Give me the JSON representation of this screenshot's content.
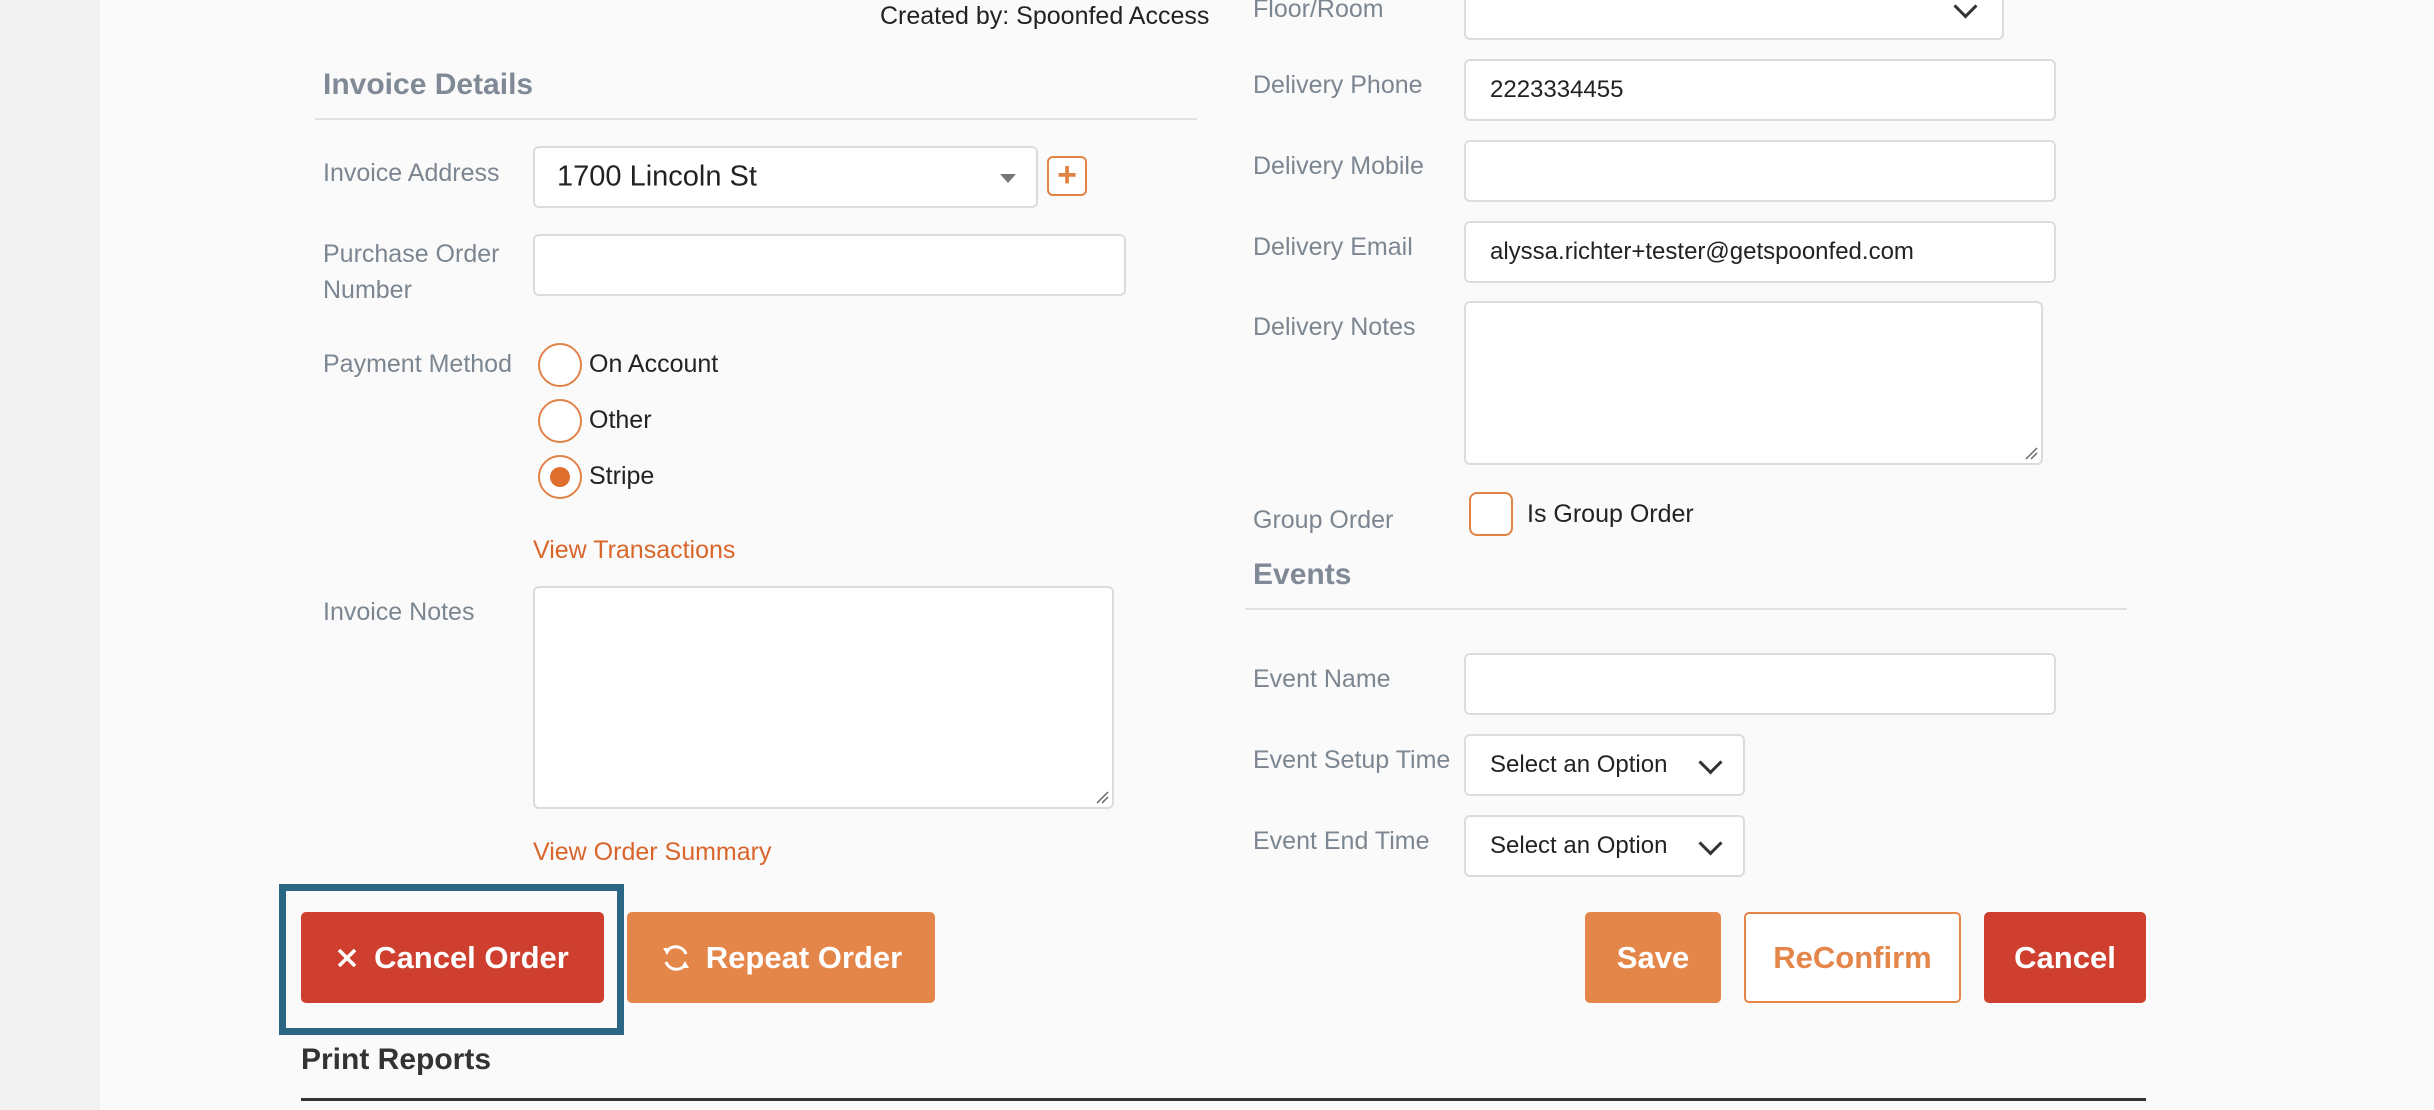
{
  "header": {
    "created_by": "Created by: Spoonfed Access"
  },
  "invoice": {
    "title": "Invoice Details",
    "address_label": "Invoice Address",
    "address_value": "1700 Lincoln St",
    "po_label_line1": "Purchase Order",
    "po_label_line2": "Number",
    "po_value": "",
    "payment_label": "Payment Method",
    "payment_options": [
      "On Account",
      "Other",
      "Stripe"
    ],
    "payment_selected": "Stripe",
    "view_transactions": "View Transactions",
    "notes_label": "Invoice Notes",
    "notes_value": "",
    "view_order_summary": "View Order Summary"
  },
  "delivery": {
    "floor_label": "Floor/Room",
    "phone_label": "Delivery Phone",
    "phone_value": "2223334455",
    "mobile_label": "Delivery Mobile",
    "mobile_value": "",
    "email_label": "Delivery Email",
    "email_value": "alyssa.richter+tester@getspoonfed.com",
    "notes_label": "Delivery Notes",
    "notes_value": "",
    "group_label": "Group Order",
    "group_checkbox_label": "Is Group Order",
    "group_checked": false
  },
  "events": {
    "title": "Events",
    "name_label": "Event Name",
    "name_value": "",
    "setup_label": "Event Setup Time",
    "setup_value": "Select an Option",
    "end_label": "Event End Time",
    "end_value": "Select an Option"
  },
  "actions": {
    "cancel_order": "Cancel Order",
    "repeat_order": "Repeat Order",
    "save": "Save",
    "reconfirm": "ReConfirm",
    "cancel": "Cancel"
  },
  "reports": {
    "title": "Print Reports"
  },
  "colors": {
    "accent": "#e48549",
    "danger": "#cf3f30",
    "highlight": "#2b6684",
    "label": "#7c8691"
  }
}
